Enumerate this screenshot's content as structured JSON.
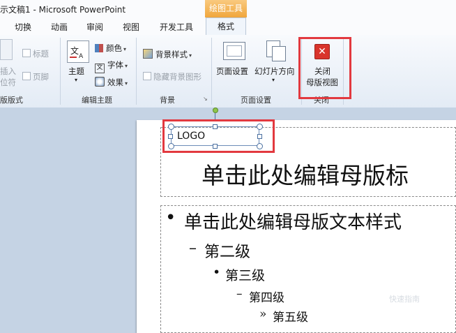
{
  "window": {
    "title": "示文稿1 - Microsoft PowerPoint",
    "tool_header": "绘图工具"
  },
  "tabs": [
    "切换",
    "动画",
    "审阅",
    "视图",
    "开发工具"
  ],
  "active_tab": "格式",
  "ribbon": {
    "layout_group": {
      "title_cb": "标题",
      "footer_cb": "页脚",
      "insert_line1": "插入",
      "insert_line2": "位符",
      "label": "版版式"
    },
    "theme_group": {
      "theme": "主题",
      "colors": "颜色",
      "fonts": "字体",
      "effects": "效果",
      "label": "编辑主题"
    },
    "bg_group": {
      "bg_styles": "背景样式",
      "hide_bg": "隐藏背景图形",
      "label": "背景"
    },
    "page_group": {
      "page_setup": "页面设置",
      "orientation": "幻灯片方向",
      "label": "页面设置"
    },
    "close_group": {
      "close_line1": "关闭",
      "close_line2": "母版视图",
      "label": "关闭"
    }
  },
  "slide": {
    "logo_text": "LOGO",
    "title_placeholder": "单击此处编辑母版标",
    "body": {
      "level1": "单击此处编辑母版文本样式",
      "level2": "第二级",
      "level3": "第三级",
      "level4": "第四级",
      "level5": "第五级"
    }
  },
  "watermark": "快速指南",
  "colors": {
    "accent_red": "#e2393f",
    "tool_tab": "#f0a63c",
    "close_icon": "#d9342b"
  }
}
